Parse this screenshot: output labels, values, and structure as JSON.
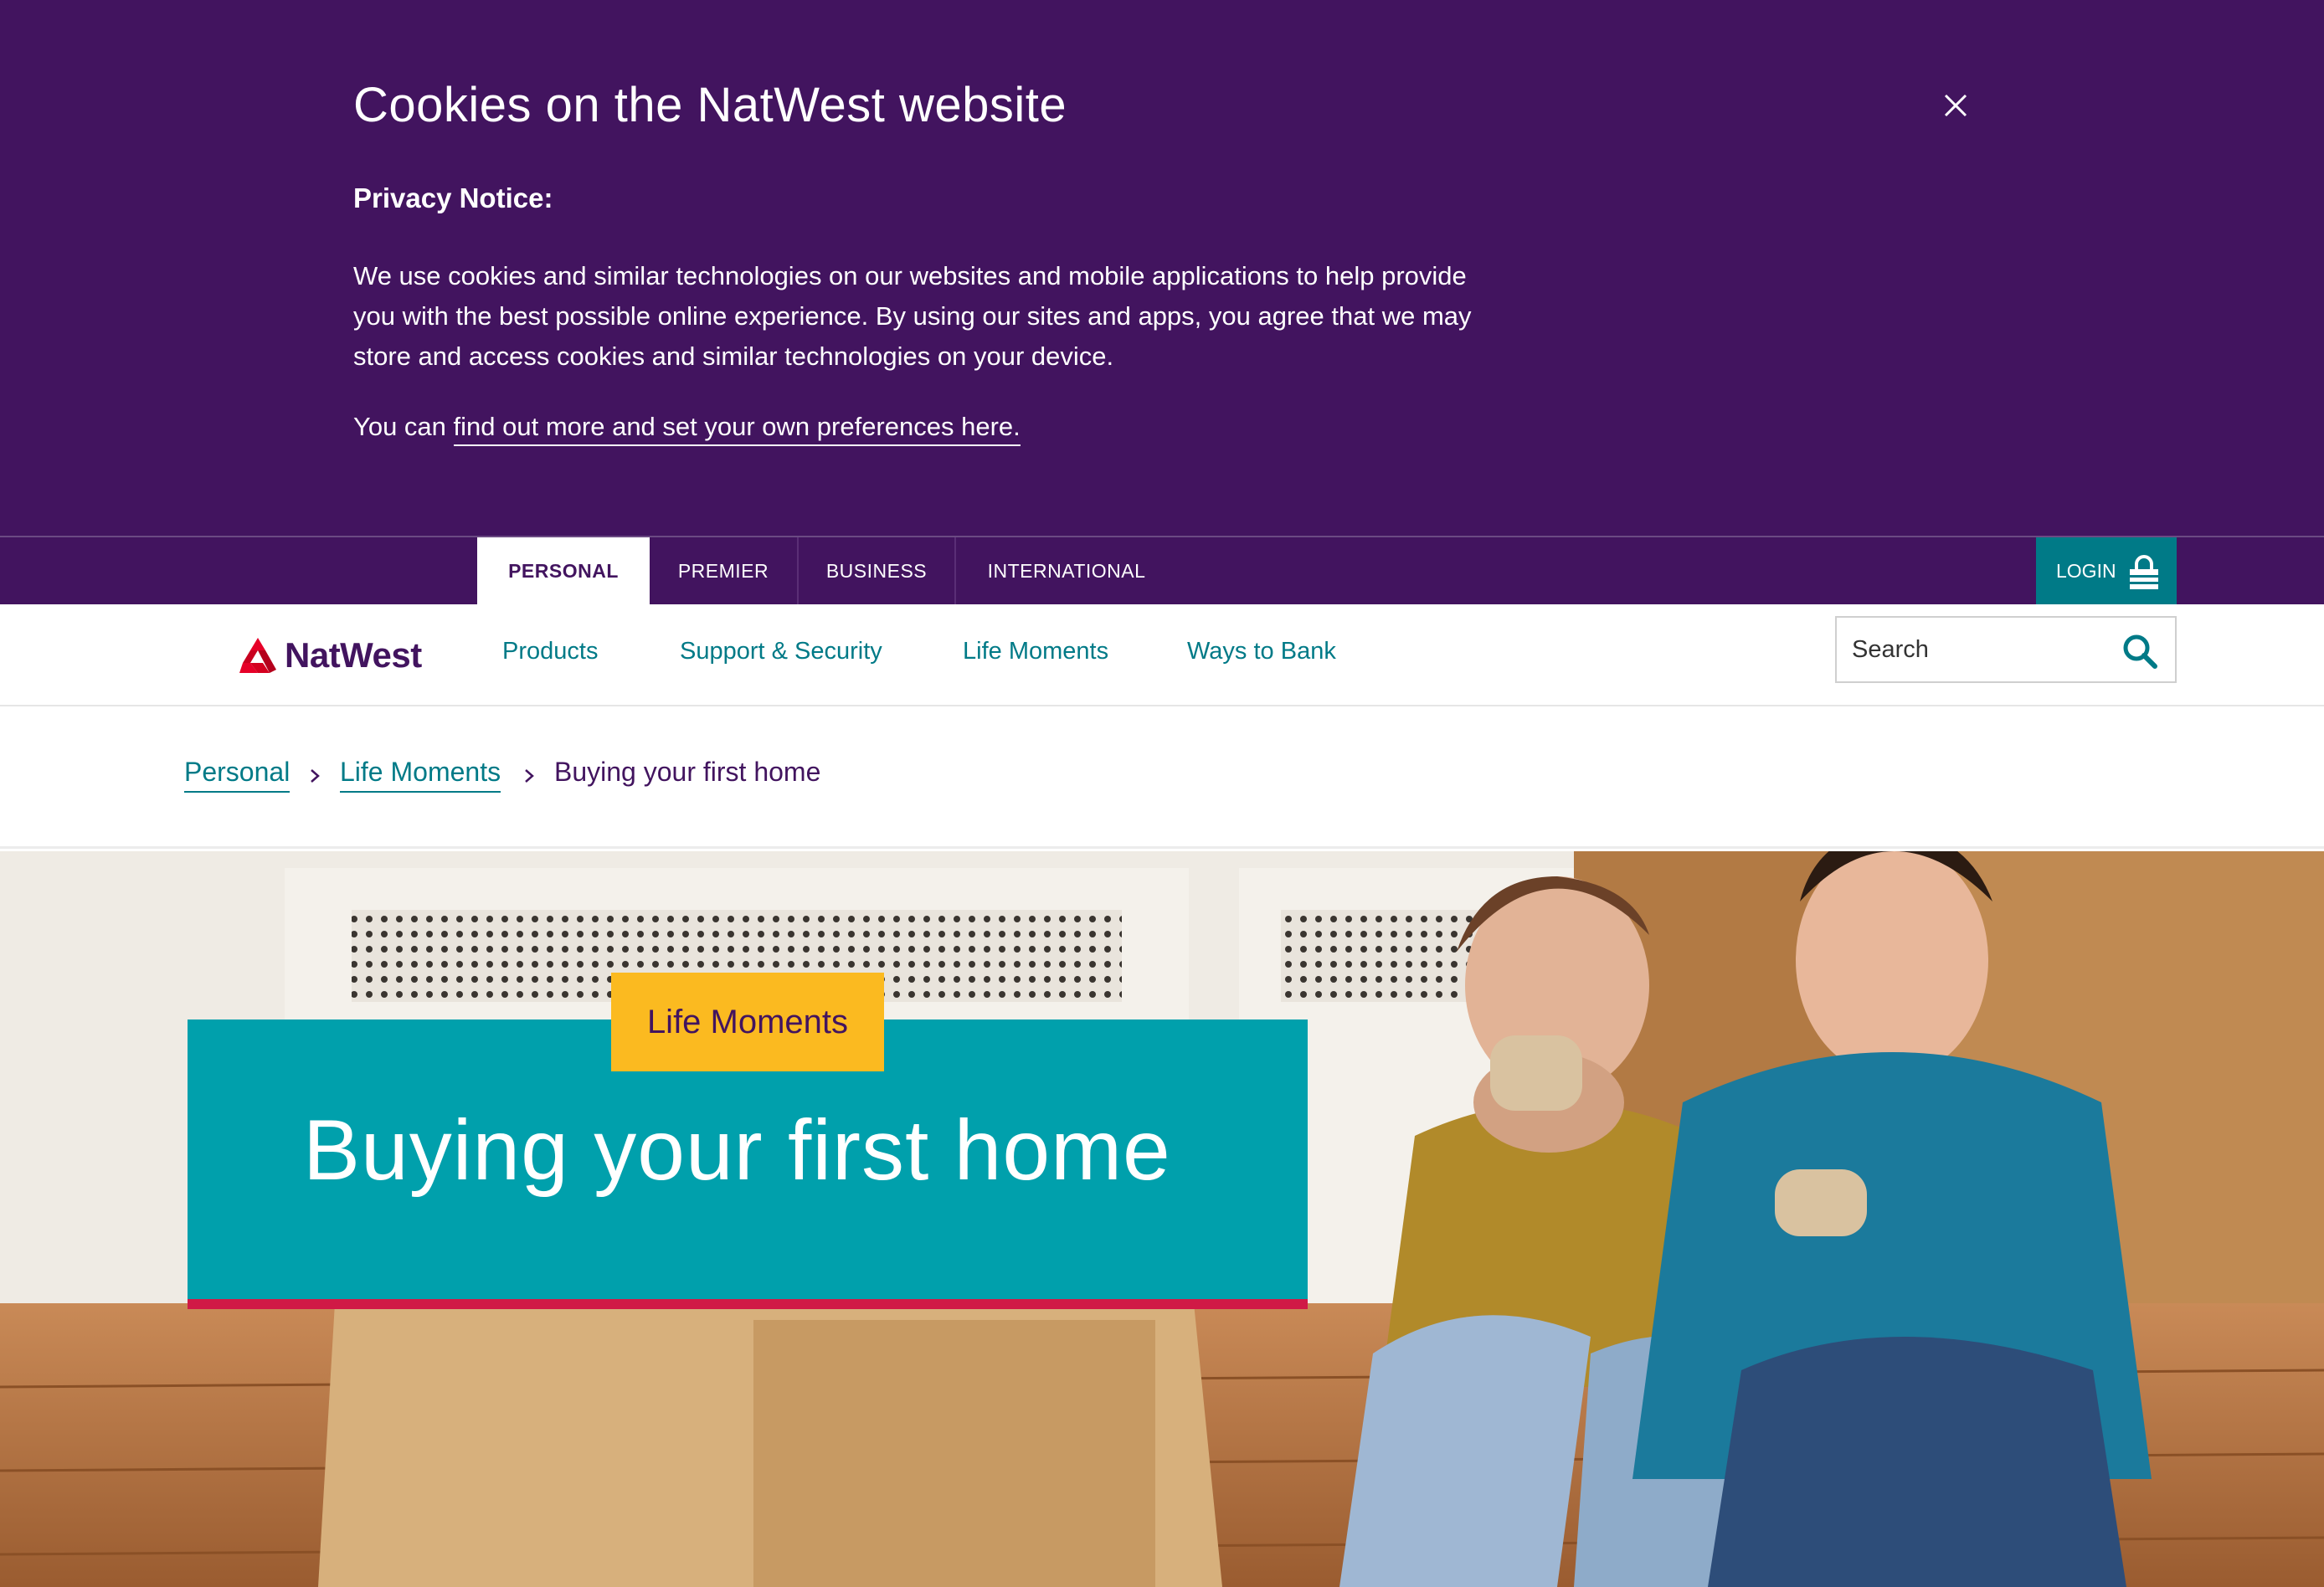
{
  "cookie_banner": {
    "title": "Cookies on the NatWest website",
    "privacy_heading": "Privacy Notice:",
    "body": "We use cookies and similar technologies on our websites and mobile applications to help provide you with the best possible online experience. By using our sites and apps, you agree that we may store and access cookies and similar technologies on your device.",
    "prefs_prefix": "You can ",
    "prefs_link": "find out more and set your own preferences here.",
    "close_icon": "close-icon"
  },
  "segment_tabs": [
    {
      "label": "PERSONAL",
      "active": true
    },
    {
      "label": "PREMIER",
      "active": false
    },
    {
      "label": "BUSINESS",
      "active": false
    },
    {
      "label": "INTERNATIONAL",
      "active": false
    }
  ],
  "login": {
    "label": "LOGIN",
    "icon": "lock-icon"
  },
  "brand": {
    "name": "NatWest",
    "color": "#42145f"
  },
  "main_nav": [
    "Products",
    "Support & Security",
    "Life Moments",
    "Ways to Bank"
  ],
  "search": {
    "placeholder": "Search",
    "icon": "search-icon"
  },
  "breadcrumb": [
    {
      "label": "Personal",
      "link": true
    },
    {
      "label": "Life Moments",
      "link": true
    },
    {
      "label": "Buying your first home",
      "link": false
    }
  ],
  "hero": {
    "tag": "Life Moments",
    "title": "Buying your first home"
  },
  "colors": {
    "purple": "#42145f",
    "teal": "#007a87",
    "hero_teal": "#00a0ac",
    "yellow": "#fbba20",
    "red": "#d01a46"
  }
}
